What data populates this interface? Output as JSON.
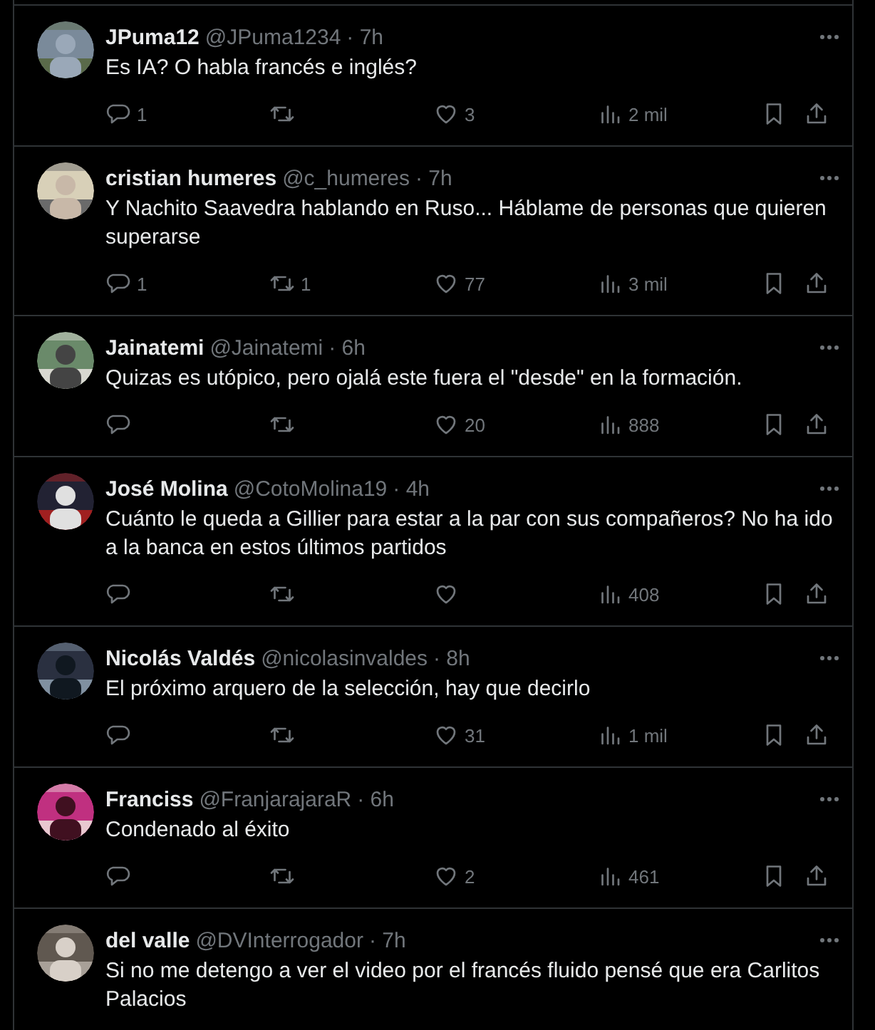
{
  "replies": [
    {
      "name": "JPuma12",
      "handle": "@JPuma1234",
      "time": "· 7h",
      "text": "Es IA? O habla francés e inglés?",
      "actions": {
        "replies": "1",
        "likes": "3",
        "views": "2 mil"
      }
    },
    {
      "name": "cristian humeres",
      "handle": "@c_humeres",
      "time": "· 7h",
      "text": "Y Nachito Saavedra hablando en Ruso... Háblame de personas que quieren superarse",
      "actions": {
        "replies": "1",
        "reposts": "1",
        "likes": "77",
        "views": "3 mil"
      }
    },
    {
      "name": "Jainatemi",
      "handle": "@Jainatemi",
      "time": "· 6h",
      "text": "Quizas es utópico, pero ojalá este fuera el \"desde\" en la formación.",
      "actions": {
        "likes": "20",
        "views": "888"
      }
    },
    {
      "name": "José Molina",
      "handle": "@CotoMolina19",
      "time": "· 4h",
      "text": "Cuánto le queda a Gillier para estar a la par con sus compañeros? No ha ido a la banca en estos últimos partidos",
      "actions": {
        "views": "408"
      }
    },
    {
      "name": "Nicolás Valdés",
      "handle": "@nicolasinvaldes",
      "time": "· 8h",
      "text": "El próximo arquero de la selección, hay que decirlo",
      "actions": {
        "likes": "31",
        "views": "1 mil"
      }
    },
    {
      "name": "Franciss",
      "handle": "@FranjarajaraR",
      "time": "· 6h",
      "text": "Condenado al éxito",
      "actions": {
        "likes": "2",
        "views": "461"
      }
    },
    {
      "name": "del valle",
      "handle": "@DVInterrogador",
      "time": "· 7h",
      "text": "Si no me detengo a ver el video por el francés fluido pensé que era Carlitos Palacios"
    }
  ]
}
